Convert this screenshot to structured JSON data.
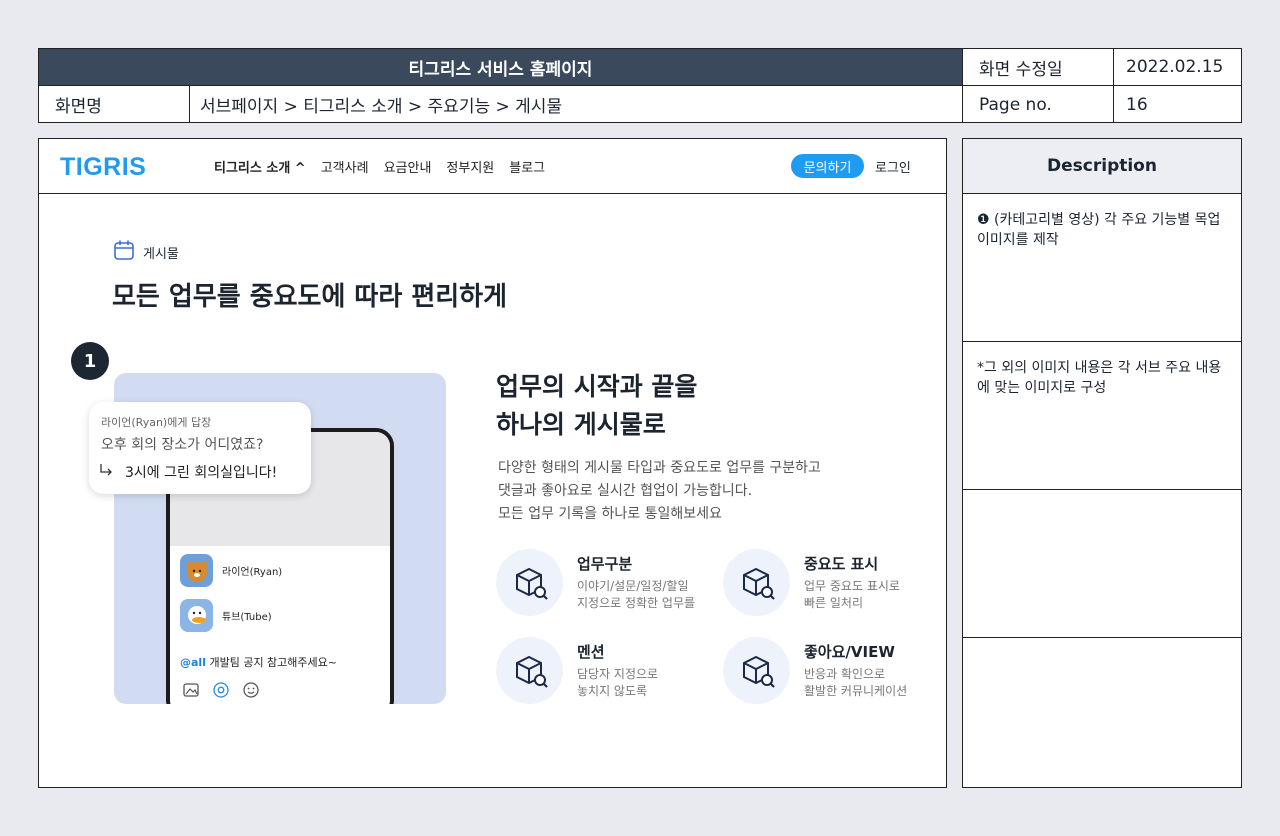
{
  "header": {
    "title": "티그리스 서비스 홈페이지",
    "date_label": "화면 수정일",
    "date_value": "2022.02.15",
    "screen_label": "화면명",
    "screen_path": "서브페이지 > 티그리스 소개 > 주요기능 > 게시물",
    "page_label": "Page no.",
    "page_value": "16"
  },
  "nav": {
    "logo": "TIGRIS",
    "items": [
      "티그리스 소개 ^",
      "고객사례",
      "요금안내",
      "정부지원",
      "블로그"
    ],
    "inquiry": "문의하기",
    "login": "로그인"
  },
  "hero": {
    "crumb": "게시물",
    "title": "모든 업무를 중요도에 따라 편리하게",
    "badge": "1",
    "heading_line1": "업무의 시작과 끝을",
    "heading_line2": "하나의 게시물로",
    "desc_line1": "다양한 형태의 게시물 타입과 중요도로 업무를 구분하고",
    "desc_line2": "댓글과 좋아요로 실시간 협업이 가능합니다.",
    "desc_line3": "모든 업무 기록을 하나로 통일해보세요"
  },
  "mock": {
    "bubble_to": "라이언(Ryan)에게 답장",
    "bubble_q": "오후 회의 장소가 어디였죠?",
    "bubble_a": "3시에 그린 회의실입니다!",
    "user1": "라이언(Ryan)",
    "user2": "튜브(Tube)",
    "mention_tag": "@all",
    "mention_text": " 개발팀 공지 참고해주세요~"
  },
  "features": [
    {
      "title": "업무구분",
      "line1": "이야기/설문/일정/할일",
      "line2": "지정으로 정확한 업무를"
    },
    {
      "title": "중요도 표시",
      "line1": "업무 중요도 표시로",
      "line2": "빠른 일처리"
    },
    {
      "title": "멘션",
      "line1": "담당자 지정으로",
      "line2": "놓치지 않도록"
    },
    {
      "title": "좋아요/VIEW",
      "line1": "반응과 확인으로",
      "line2": "활발한 커뮤니케이션"
    }
  ],
  "description": {
    "heading": "Description",
    "row1": "❶ (카테고리별 영상) 각 주요 기능별 목업 이미지를 제작",
    "row2": "*그 외의 이미지 내용은 각 서브 주요 내용에 맞는 이미지로 구성",
    "row3": "",
    "row4": ""
  }
}
